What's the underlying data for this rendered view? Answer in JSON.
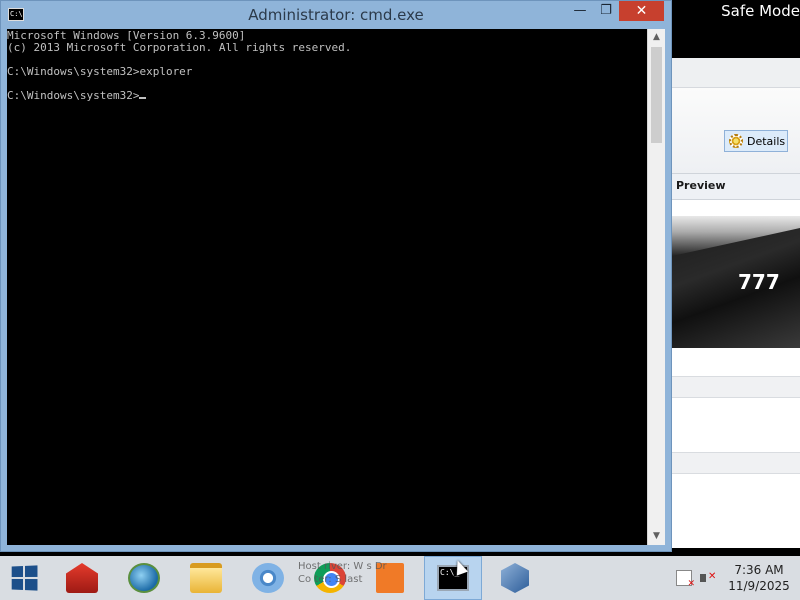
{
  "desktop": {
    "safe_mode_label": "Safe Mode"
  },
  "background_window": {
    "details_button": "Details",
    "preview_header": "Preview",
    "preview_number": "777"
  },
  "cmd_window": {
    "title": "Administrator: cmd.exe",
    "controls": {
      "minimize": "—",
      "maximize": "❐",
      "close": "✕"
    },
    "console_lines": [
      "Microsoft Windows [Version 6.3.9600]",
      "(c) 2013 Microsoft Corporation. All rights reserved.",
      "",
      "C:\\Windows\\system32>explorer",
      "",
      "C:\\Windows\\system32>"
    ]
  },
  "taskbar": {
    "ghost_text": {
      "line1": "Host river:    W    s Dr",
      "line2": "Co   ter:     S    last"
    },
    "clock": {
      "time": "7:36 AM",
      "date": "11/9/2025"
    }
  }
}
